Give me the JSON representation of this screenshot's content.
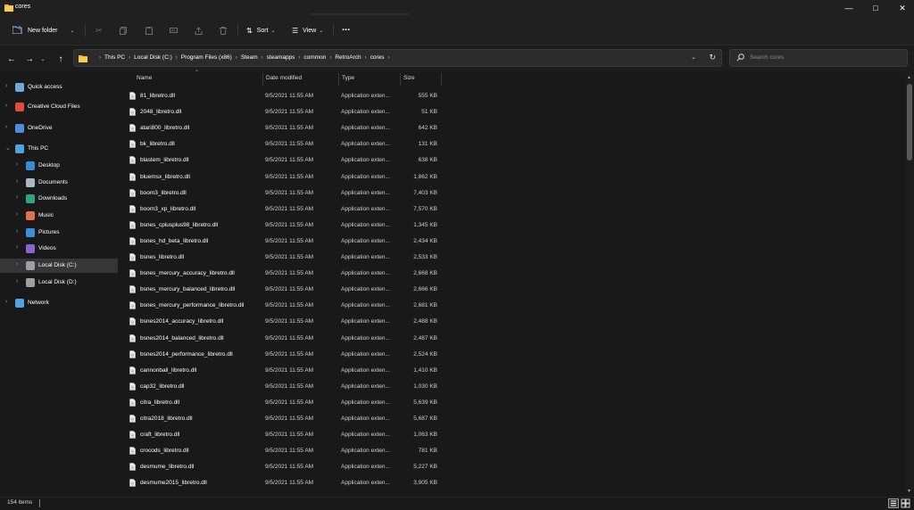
{
  "window": {
    "title": "cores",
    "minimize_icon": "minimize-icon",
    "maximize_icon": "maximize-icon",
    "close_icon": "close-icon"
  },
  "toolbar": {
    "new_folder": "New folder",
    "sort": "Sort",
    "view": "View",
    "more": "..."
  },
  "address": {
    "crumbs": [
      "This PC",
      "Local Disk (C:)",
      "Program Files (x86)",
      "Steam",
      "steamapps",
      "common",
      "RetroArch",
      "cores"
    ]
  },
  "search": {
    "placeholder": "Search cores"
  },
  "sidebar": {
    "items": [
      {
        "label": "Quick access",
        "icon": "star-icon"
      },
      {
        "label": "Creative Cloud Files",
        "icon": "creative-cloud-icon"
      },
      {
        "label": "OneDrive",
        "icon": "cloud-icon"
      },
      {
        "label": "This PC",
        "icon": "computer-icon"
      },
      {
        "label": "Desktop",
        "icon": "desktop-icon"
      },
      {
        "label": "Documents",
        "icon": "documents-icon"
      },
      {
        "label": "Downloads",
        "icon": "download-icon"
      },
      {
        "label": "Music",
        "icon": "music-icon"
      },
      {
        "label": "Pictures",
        "icon": "pictures-icon"
      },
      {
        "label": "Videos",
        "icon": "videos-icon"
      },
      {
        "label": "Local Disk (C:)",
        "icon": "drive-icon"
      },
      {
        "label": "Local Disk (D:)",
        "icon": "drive-icon"
      },
      {
        "label": "Network",
        "icon": "network-icon"
      }
    ]
  },
  "columns": {
    "name": "Name",
    "date": "Date modified",
    "type": "Type",
    "size": "Size"
  },
  "files": [
    {
      "name": "81_libretro.dll",
      "date": "9/5/2021 11:55 AM",
      "type": "Application exten...",
      "size": "555 KB"
    },
    {
      "name": "2048_libretro.dll",
      "date": "9/5/2021 11:55 AM",
      "type": "Application exten...",
      "size": "51 KB"
    },
    {
      "name": "atari800_libretro.dll",
      "date": "9/5/2021 11:55 AM",
      "type": "Application exten...",
      "size": "642 KB"
    },
    {
      "name": "bk_libretro.dll",
      "date": "9/5/2021 11:55 AM",
      "type": "Application exten...",
      "size": "131 KB"
    },
    {
      "name": "blastem_libretro.dll",
      "date": "9/5/2021 11:55 AM",
      "type": "Application exten...",
      "size": "638 KB"
    },
    {
      "name": "bluemsx_libretro.dll",
      "date": "9/5/2021 11:55 AM",
      "type": "Application exten...",
      "size": "1,862 KB"
    },
    {
      "name": "boom3_libretro.dll",
      "date": "9/5/2021 11:55 AM",
      "type": "Application exten...",
      "size": "7,403 KB"
    },
    {
      "name": "boom3_xp_libretro.dll",
      "date": "9/5/2021 11:55 AM",
      "type": "Application exten...",
      "size": "7,570 KB"
    },
    {
      "name": "bsnes_cplusplus98_libretro.dll",
      "date": "9/5/2021 11:55 AM",
      "type": "Application exten...",
      "size": "1,345 KB"
    },
    {
      "name": "bsnes_hd_beta_libretro.dll",
      "date": "9/5/2021 11:55 AM",
      "type": "Application exten...",
      "size": "2,434 KB"
    },
    {
      "name": "bsnes_libretro.dll",
      "date": "9/5/2021 11:55 AM",
      "type": "Application exten...",
      "size": "2,533 KB"
    },
    {
      "name": "bsnes_mercury_accuracy_libretro.dll",
      "date": "9/5/2021 11:55 AM",
      "type": "Application exten...",
      "size": "2,668 KB"
    },
    {
      "name": "bsnes_mercury_balanced_libretro.dll",
      "date": "9/5/2021 11:55 AM",
      "type": "Application exten...",
      "size": "2,666 KB"
    },
    {
      "name": "bsnes_mercury_performance_libretro.dll",
      "date": "9/5/2021 11:55 AM",
      "type": "Application exten...",
      "size": "2,681 KB"
    },
    {
      "name": "bsnes2014_accuracy_libretro.dll",
      "date": "9/5/2021 11:55 AM",
      "type": "Application exten...",
      "size": "2,488 KB"
    },
    {
      "name": "bsnes2014_balanced_libretro.dll",
      "date": "9/5/2021 11:55 AM",
      "type": "Application exten...",
      "size": "2,487 KB"
    },
    {
      "name": "bsnes2014_performance_libretro.dll",
      "date": "9/5/2021 11:55 AM",
      "type": "Application exten...",
      "size": "2,524 KB"
    },
    {
      "name": "cannonball_libretro.dll",
      "date": "9/5/2021 11:55 AM",
      "type": "Application exten...",
      "size": "1,410 KB"
    },
    {
      "name": "cap32_libretro.dll",
      "date": "9/5/2021 11:55 AM",
      "type": "Application exten...",
      "size": "1,030 KB"
    },
    {
      "name": "citra_libretro.dll",
      "date": "9/5/2021 11:55 AM",
      "type": "Application exten...",
      "size": "5,639 KB"
    },
    {
      "name": "citra2018_libretro.dll",
      "date": "9/5/2021 11:55 AM",
      "type": "Application exten...",
      "size": "5,687 KB"
    },
    {
      "name": "craft_libretro.dll",
      "date": "9/5/2021 11:55 AM",
      "type": "Application exten...",
      "size": "1,063 KB"
    },
    {
      "name": "crocods_libretro.dll",
      "date": "9/5/2021 11:55 AM",
      "type": "Application exten...",
      "size": "781 KB"
    },
    {
      "name": "desmume_libretro.dll",
      "date": "9/5/2021 11:55 AM",
      "type": "Application exten...",
      "size": "5,227 KB"
    },
    {
      "name": "desmume2015_libretro.dll",
      "date": "9/5/2021 11:55 AM",
      "type": "Application exten...",
      "size": "3,905 KB"
    }
  ],
  "status": {
    "item_count": "154 items"
  }
}
